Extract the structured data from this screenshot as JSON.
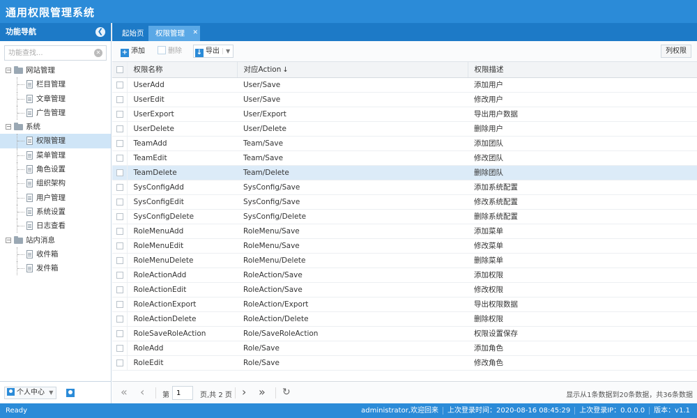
{
  "app": {
    "title": "通用权限管理系统"
  },
  "sidebar": {
    "header": "功能导航",
    "search_placeholder": "功能查找...",
    "tree": [
      {
        "label": "网站管理",
        "type": "folder",
        "level": 0
      },
      {
        "label": "栏目管理",
        "type": "file",
        "level": 1
      },
      {
        "label": "文章管理",
        "type": "file",
        "level": 1
      },
      {
        "label": "广告管理",
        "type": "file",
        "level": 1
      },
      {
        "label": "系统",
        "type": "folder",
        "level": 0
      },
      {
        "label": "权限管理",
        "type": "file",
        "level": 1,
        "selected": true
      },
      {
        "label": "菜单管理",
        "type": "file",
        "level": 1
      },
      {
        "label": "角色设置",
        "type": "file",
        "level": 1
      },
      {
        "label": "组织架构",
        "type": "file",
        "level": 1
      },
      {
        "label": "用户管理",
        "type": "file",
        "level": 1
      },
      {
        "label": "系统设置",
        "type": "file",
        "level": 1
      },
      {
        "label": "日志查看",
        "type": "file",
        "level": 1
      },
      {
        "label": "站内消息",
        "type": "folder",
        "level": 0
      },
      {
        "label": "收件箱",
        "type": "file",
        "level": 1
      },
      {
        "label": "发件箱",
        "type": "file",
        "level": 1
      }
    ],
    "user_center": "个人中心"
  },
  "tabs": {
    "home": "起始页",
    "active": "权限管理"
  },
  "toolbar": {
    "add": "添加",
    "delete": "删除",
    "export": "导出",
    "columns": "列权限"
  },
  "table": {
    "columns": [
      "权限名称",
      "对应Action",
      "权限描述"
    ],
    "sort_indicator": "↓",
    "rows": [
      [
        "UserAdd",
        "User/Save",
        "添加用户"
      ],
      [
        "UserEdit",
        "User/Save",
        "修改用户"
      ],
      [
        "UserExport",
        "User/Export",
        "导出用户数据"
      ],
      [
        "UserDelete",
        "User/Delete",
        "删除用户"
      ],
      [
        "TeamAdd",
        "Team/Save",
        "添加团队"
      ],
      [
        "TeamEdit",
        "Team/Save",
        "修改团队"
      ],
      [
        "TeamDelete",
        "Team/Delete",
        "删除团队"
      ],
      [
        "SysConfigAdd",
        "SysConfig/Save",
        "添加系统配置"
      ],
      [
        "SysConfigEdit",
        "SysConfig/Save",
        "修改系统配置"
      ],
      [
        "SysConfigDelete",
        "SysConfig/Delete",
        "删除系统配置"
      ],
      [
        "RoleMenuAdd",
        "RoleMenu/Save",
        "添加菜单"
      ],
      [
        "RoleMenuEdit",
        "RoleMenu/Save",
        "修改菜单"
      ],
      [
        "RoleMenuDelete",
        "RoleMenu/Delete",
        "删除菜单"
      ],
      [
        "RoleActionAdd",
        "RoleAction/Save",
        "添加权限"
      ],
      [
        "RoleActionEdit",
        "RoleAction/Save",
        "修改权限"
      ],
      [
        "RoleActionExport",
        "RoleAction/Export",
        "导出权限数据"
      ],
      [
        "RoleActionDelete",
        "RoleAction/Delete",
        "删除权限"
      ],
      [
        "RoleSaveRoleAction",
        "Role/SaveRoleAction",
        "权限设置保存"
      ],
      [
        "RoleAdd",
        "Role/Save",
        "添加角色"
      ],
      [
        "RoleEdit",
        "Role/Save",
        "修改角色"
      ]
    ],
    "selected_row": 6
  },
  "pager": {
    "page_label": "第",
    "current_page": "1",
    "total_label": "页,共 2 页",
    "info": "显示从1条数据到20条数据，共36条数据"
  },
  "statusbar": {
    "ready": "Ready",
    "user": "administrator,欢迎回来",
    "last_login_time": "上次登录时间：2020-08-16 08:45:29",
    "last_login_ip": "上次登录IP：0.0.0.0",
    "version": "版本：v1.1"
  },
  "colors": {
    "primary": "#2b8bd8",
    "header": "#1d7ac7",
    "selected_row": "#dcebf8"
  }
}
